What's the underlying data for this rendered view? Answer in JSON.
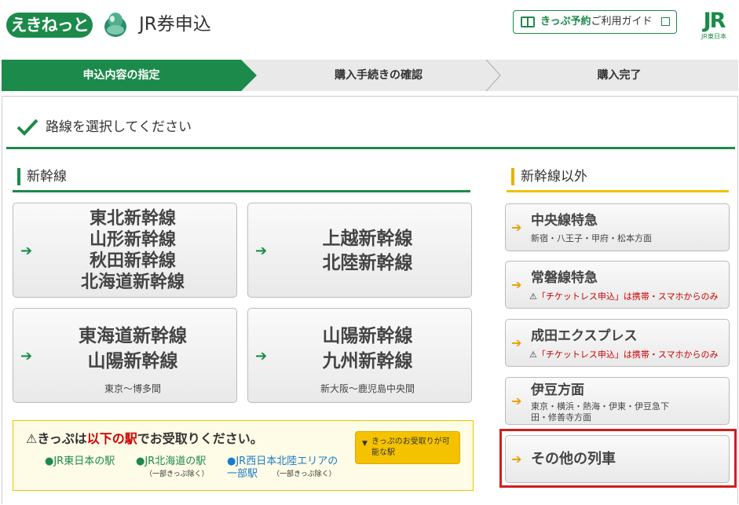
{
  "header": {
    "logo_text": "えきねっと",
    "app_title": "JR券申込",
    "guide_bold": "きっぷ予約",
    "guide_rest": "ご利用ガイド",
    "jr_logo": "JR",
    "jr_logo_sub": "JR東日本"
  },
  "steps": [
    {
      "label": "申込内容の指定",
      "active": true
    },
    {
      "label": "購入手続きの確認",
      "active": false
    },
    {
      "label": "購入完了",
      "active": false
    }
  ],
  "instruction": "路線を選択してください",
  "shinkansen": {
    "heading": "新幹線",
    "routes": [
      {
        "names": [
          "東北新幹線",
          "山形新幹線",
          "秋田新幹線",
          "北海道新幹線"
        ],
        "note": ""
      },
      {
        "names": [
          "上越新幹線",
          "北陸新幹線"
        ],
        "note": ""
      },
      {
        "names": [
          "東海道新幹線",
          "山陽新幹線"
        ],
        "note": "東京〜博多間"
      },
      {
        "names": [
          "山陽新幹線",
          "九州新幹線"
        ],
        "note": "新大阪〜鹿児島中央間"
      }
    ]
  },
  "other": {
    "heading": "新幹線以外",
    "routes": [
      {
        "name": "中央線特急",
        "sub": "新宿・八王子・甲府・松本方面",
        "warning": ""
      },
      {
        "name": "常磐線特急",
        "sub": "",
        "warning": "「チケットレス申込」は携帯・スマホからのみ"
      },
      {
        "name": "成田エクスプレス",
        "sub": "",
        "warning": "「チケットレス申込」は携帯・スマホからのみ"
      },
      {
        "name": "伊豆方面",
        "sub": "東京・横浜・熱海・伊東・伊豆急下田・修善寺方面",
        "warning": ""
      },
      {
        "name": "その他の列車",
        "sub": "",
        "warning": ""
      }
    ]
  },
  "notice": {
    "title_pre": "きっぷは",
    "title_red": "以下の駅",
    "title_post": "でお受取りください。",
    "button_label": "きっぷのお受取りが可能な駅",
    "areas": [
      {
        "label": "JR東日本の駅",
        "note": ""
      },
      {
        "label": "JR北海道の駅",
        "note": "（一部きっぷ除く）"
      },
      {
        "label": "JR西日本北陸エリアの一部駅",
        "note": "（一部きっぷ除く）"
      }
    ]
  },
  "colors": {
    "brand_green": "#1c8a4a",
    "accent_yellow": "#f0c200",
    "warning_red": "#cc0000",
    "highlight_red": "#d01e1e"
  }
}
